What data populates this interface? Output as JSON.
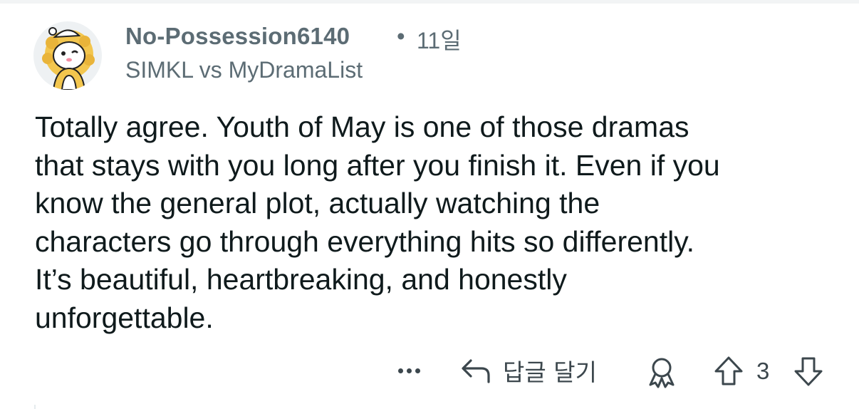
{
  "comment": {
    "author": "No-Possession6140",
    "separator": "•",
    "time_ago": "11일",
    "post_title": "SIMKL vs MyDramaList",
    "body_lines": [
      "Totally agree. Youth of May is one of those dramas",
      "that stays with you long after you finish it. Even if you",
      "know the general plot, actually watching the",
      "characters go through everything hits so differently.",
      "It’s beautiful, heartbreaking, and honestly",
      "unforgettable."
    ],
    "avatar_icon": "snoo-lion-avatar-icon"
  },
  "actions": {
    "more_icon": "ellipsis-icon",
    "reply_icon": "reply-arrow-icon",
    "reply_label": "답글 달기",
    "award_icon": "award-icon",
    "upvote_icon": "upvote-arrow-icon",
    "vote_count": "3",
    "downvote_icon": "downvote-arrow-icon"
  },
  "colors": {
    "meta_text": "#5c6c74",
    "body_text": "#0f1a1c",
    "action_icon": "#3c474d",
    "avatar_bg": "#eef1f3",
    "avatar_fur": "#f3c64e"
  }
}
